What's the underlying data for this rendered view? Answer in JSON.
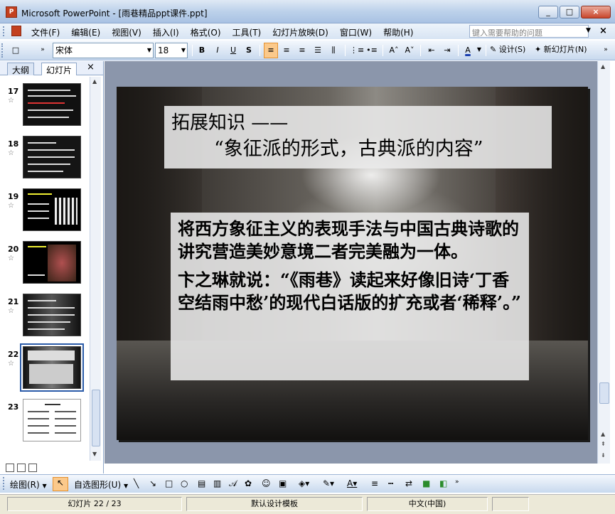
{
  "window": {
    "title": "Microsoft PowerPoint - [雨巷精品ppt课件.ppt]",
    "buttons": [
      "_",
      "□",
      "×"
    ]
  },
  "menubar": {
    "items": [
      "文件(F)",
      "编辑(E)",
      "视图(V)",
      "插入(I)",
      "格式(O)",
      "工具(T)",
      "幻灯片放映(D)",
      "窗口(W)",
      "帮助(H)"
    ],
    "help_placeholder": "键入需要帮助的问题",
    "close": "×"
  },
  "toolbar": {
    "font": "宋体",
    "size": "18",
    "bold": "B",
    "italic": "I",
    "underline": "U",
    "shadow": "S",
    "design": "设计(S)",
    "new_slide": "新幻灯片(N)",
    "font_color_letter": "A"
  },
  "panel": {
    "tabs": [
      "大纲",
      "幻灯片"
    ],
    "close": "×",
    "slides": [
      {
        "num": "17"
      },
      {
        "num": "18"
      },
      {
        "num": "19"
      },
      {
        "num": "20"
      },
      {
        "num": "21"
      },
      {
        "num": "22"
      },
      {
        "num": "23"
      }
    ]
  },
  "slide": {
    "title_line1": "拓展知识 ——",
    "title_line2": "“象征派的形式，古典派的内容”",
    "para1": "将西方象征主义的表现手法与中国古典诗歌的讲究营造美妙意境二者完美融为一体。",
    "para2": "卞之琳就说：“《雨巷》读起来好像旧诗‘丁香空结雨中愁’的现代白话版的扩充或者‘稀释’。”"
  },
  "drawbar": {
    "draw": "绘图(R)",
    "autoshapes": "自选图形(U)"
  },
  "status": {
    "slide": "幻灯片 22 / 23",
    "template": "默认设计模板",
    "language": "中文(中国)"
  }
}
